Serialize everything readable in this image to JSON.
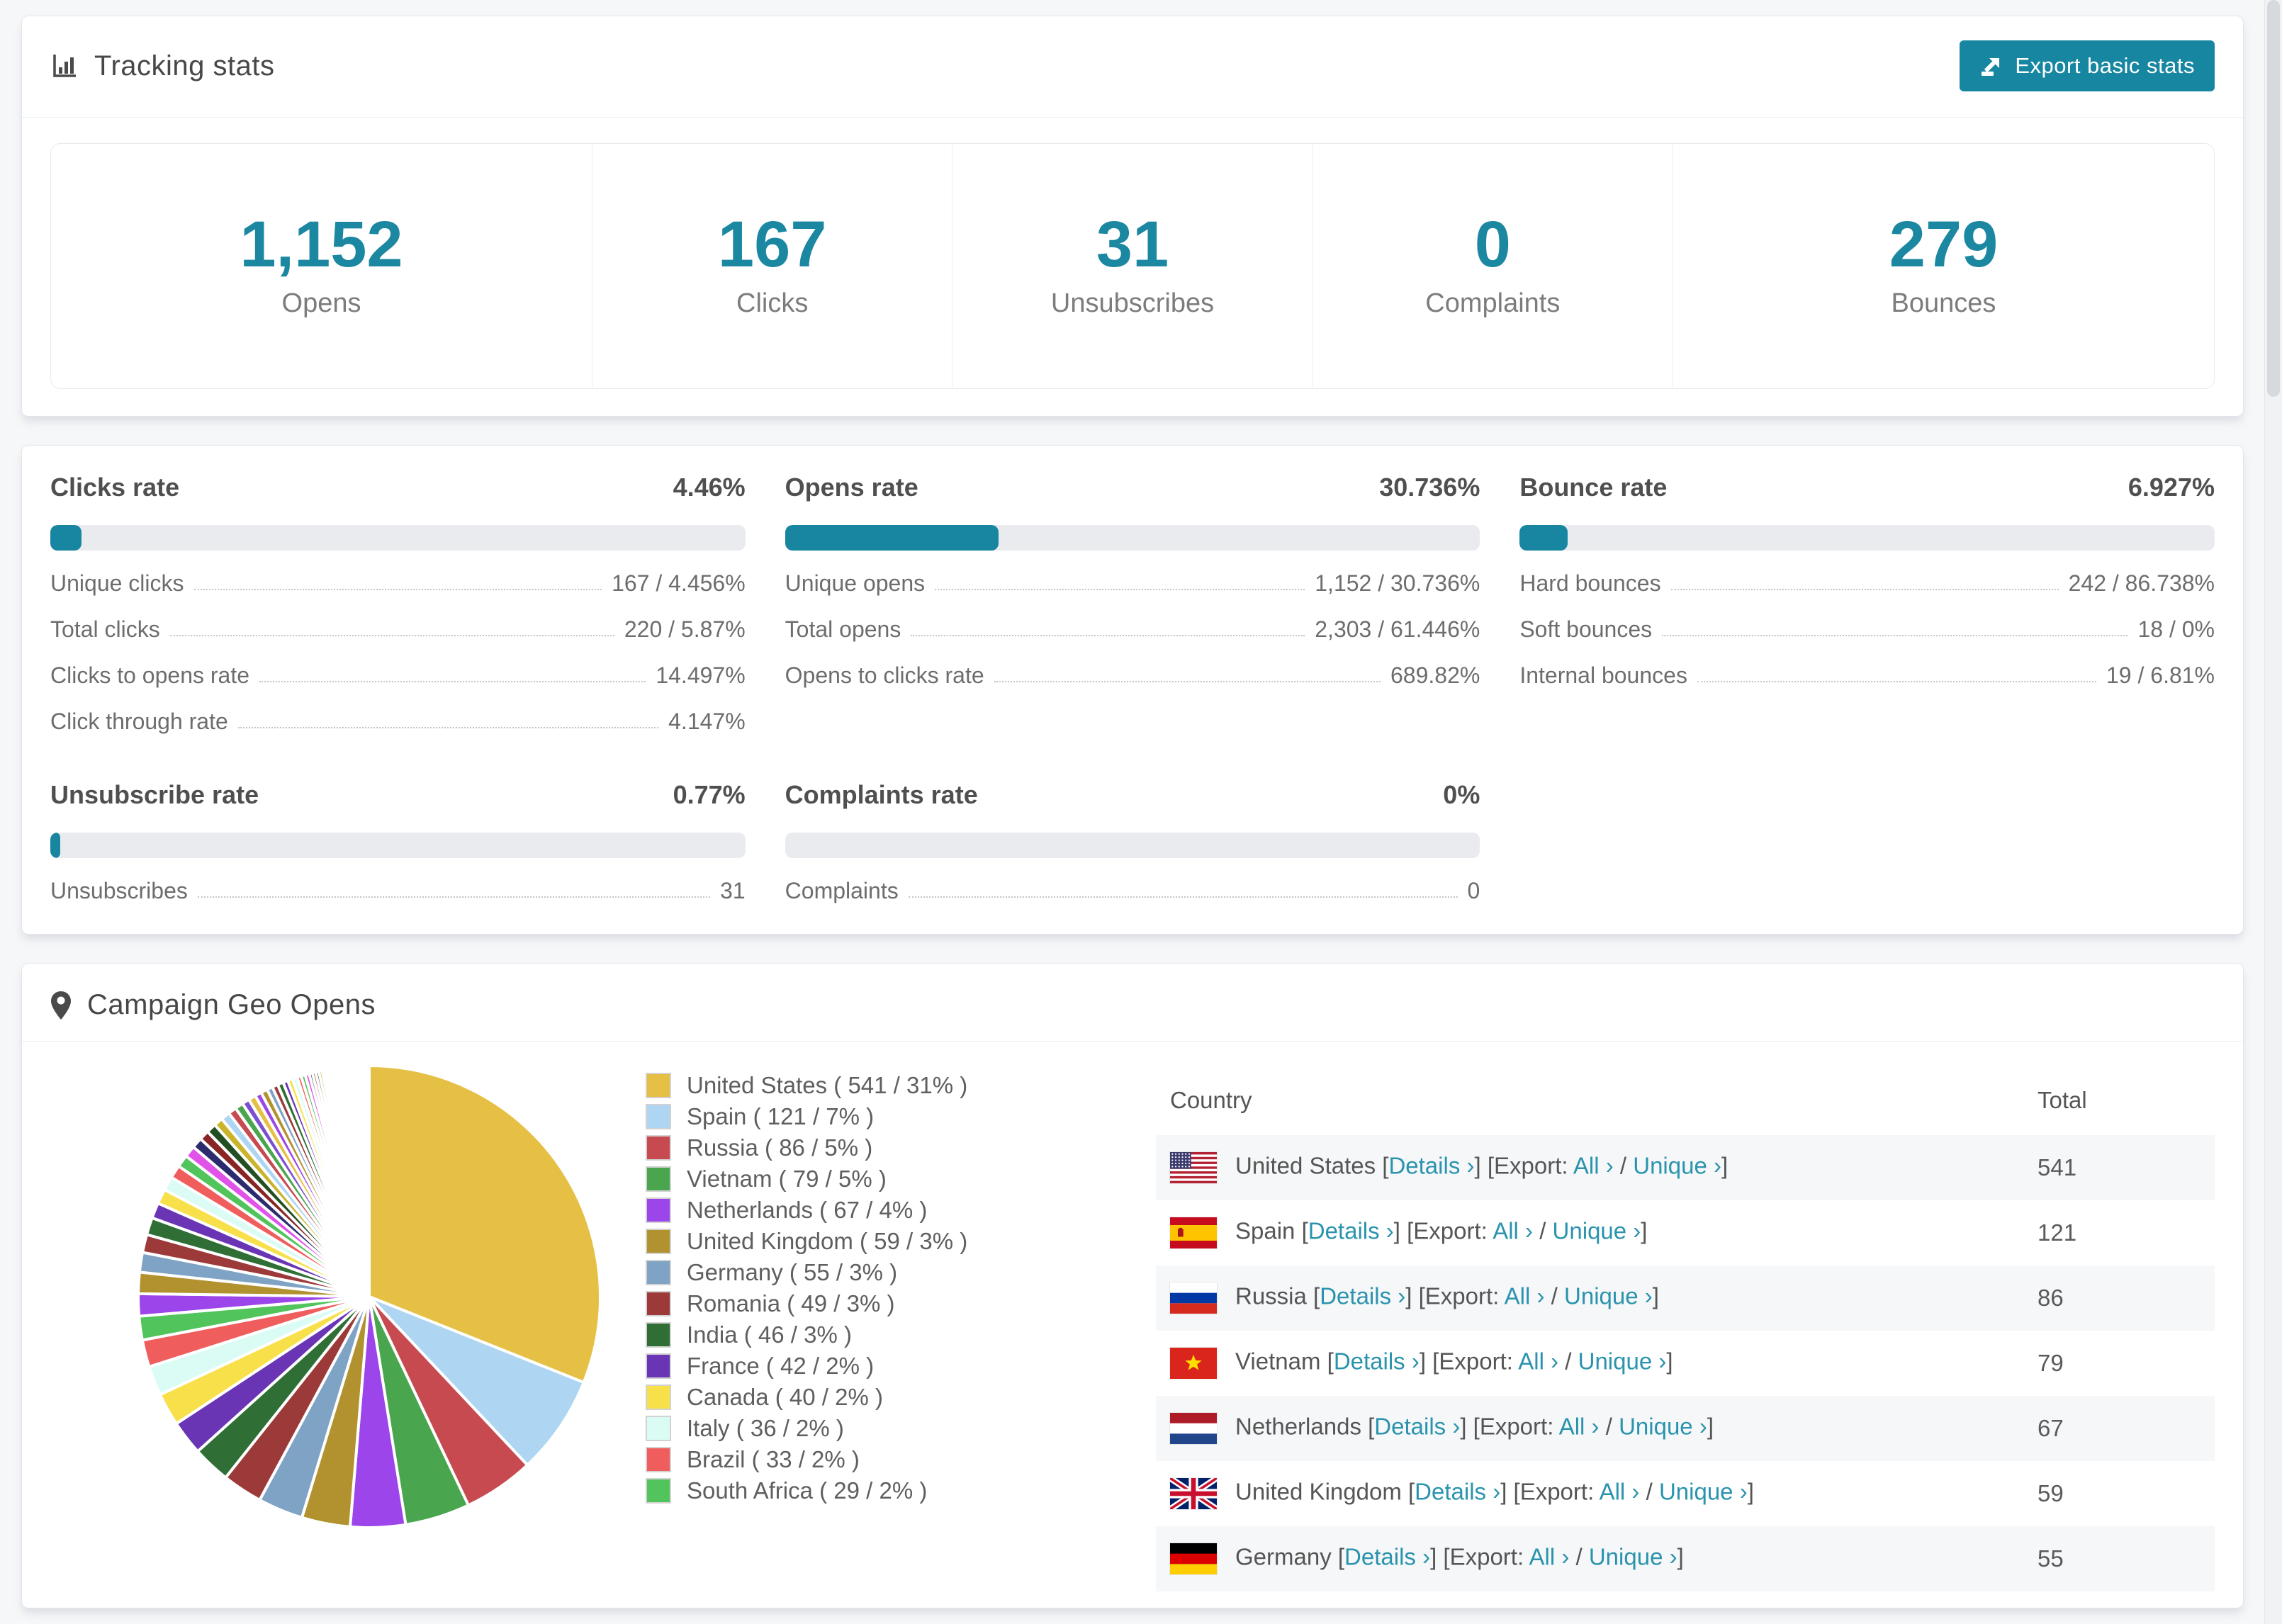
{
  "header": {
    "title": "Tracking stats",
    "export_label": "Export basic stats"
  },
  "summary": [
    {
      "value": "1,152",
      "label": "Opens"
    },
    {
      "value": "167",
      "label": "Clicks"
    },
    {
      "value": "31",
      "label": "Unsubscribes"
    },
    {
      "value": "0",
      "label": "Complaints"
    },
    {
      "value": "279",
      "label": "Bounces"
    }
  ],
  "rates": [
    {
      "title": "Clicks rate",
      "value": "4.46%",
      "percent": 4.46,
      "rows": [
        {
          "label": "Unique clicks",
          "value": "167 / 4.456%"
        },
        {
          "label": "Total clicks",
          "value": "220 / 5.87%"
        },
        {
          "label": "Clicks to opens rate",
          "value": "14.497%"
        },
        {
          "label": "Click through rate",
          "value": "4.147%"
        }
      ]
    },
    {
      "title": "Opens rate",
      "value": "30.736%",
      "percent": 30.736,
      "rows": [
        {
          "label": "Unique opens",
          "value": "1,152 / 30.736%"
        },
        {
          "label": "Total opens",
          "value": "2,303 / 61.446%"
        },
        {
          "label": "Opens to clicks rate",
          "value": "689.82%"
        }
      ]
    },
    {
      "title": "Bounce rate",
      "value": "6.927%",
      "percent": 6.927,
      "rows": [
        {
          "label": "Hard bounces",
          "value": "242 / 86.738%"
        },
        {
          "label": "Soft bounces",
          "value": "18 / 0%"
        },
        {
          "label": "Internal bounces",
          "value": "19 / 6.81%"
        }
      ]
    },
    {
      "title": "Unsubscribe rate",
      "value": "0.77%",
      "percent": 0.77,
      "rows": [
        {
          "label": "Unsubscribes",
          "value": "31"
        }
      ]
    },
    {
      "title": "Complaints rate",
      "value": "0%",
      "percent": 0,
      "rows": [
        {
          "label": "Complaints",
          "value": "0"
        }
      ]
    }
  ],
  "geo": {
    "title": "Campaign Geo Opens",
    "table": {
      "columns": [
        "Country",
        "Total"
      ],
      "link_labels": {
        "details": "Details ›",
        "export_prefix": "[Export: ",
        "all": "All ›",
        "separator": " / ",
        "unique": "Unique ›"
      },
      "rows": [
        {
          "country": "United States",
          "flag": "us",
          "total": "541"
        },
        {
          "country": "Spain",
          "flag": "es",
          "total": "121"
        },
        {
          "country": "Russia",
          "flag": "ru",
          "total": "86"
        },
        {
          "country": "Vietnam",
          "flag": "vn",
          "total": "79"
        },
        {
          "country": "Netherlands",
          "flag": "nl",
          "total": "67"
        },
        {
          "country": "United Kingdom",
          "flag": "gb",
          "total": "59"
        },
        {
          "country": "Germany",
          "flag": "de",
          "total": "55"
        }
      ]
    }
  },
  "chart_data": {
    "type": "pie",
    "title": "Campaign Geo Opens",
    "legend_position": "right",
    "start_angle_deg": 0,
    "direction": "clockwise",
    "series": [
      {
        "label": "United States",
        "value": 541,
        "share": "31%",
        "color": "#e5c044"
      },
      {
        "label": "Spain",
        "value": 121,
        "share": "7%",
        "color": "#aed5f2"
      },
      {
        "label": "Russia",
        "value": 86,
        "share": "5%",
        "color": "#c74a50"
      },
      {
        "label": "Vietnam",
        "value": 79,
        "share": "5%",
        "color": "#4aa64e"
      },
      {
        "label": "Netherlands",
        "value": 67,
        "share": "4%",
        "color": "#9b45ea"
      },
      {
        "label": "United Kingdom",
        "value": 59,
        "share": "3%",
        "color": "#b2922f"
      },
      {
        "label": "Germany",
        "value": 55,
        "share": "3%",
        "color": "#7fa3c4"
      },
      {
        "label": "Romania",
        "value": 49,
        "share": "3%",
        "color": "#9c3a3a"
      },
      {
        "label": "India",
        "value": 46,
        "share": "3%",
        "color": "#2f6e35"
      },
      {
        "label": "France",
        "value": 42,
        "share": "2%",
        "color": "#6a35b5"
      },
      {
        "label": "Canada",
        "value": 40,
        "share": "2%",
        "color": "#f7e04a"
      },
      {
        "label": "Italy",
        "value": 36,
        "share": "2%",
        "color": "#dafcf4"
      },
      {
        "label": "Brazil",
        "value": 33,
        "share": "2%",
        "color": "#ef5d5d"
      },
      {
        "label": "South Africa",
        "value": 29,
        "share": "2%",
        "color": "#52c45c"
      }
    ],
    "others_values": [
      27,
      26,
      24,
      22,
      21,
      19,
      18,
      17,
      16,
      15,
      14,
      13,
      12,
      12,
      11,
      11,
      10,
      10,
      9,
      9,
      8,
      8,
      7,
      7,
      7,
      6,
      6,
      6,
      5,
      5,
      5,
      4,
      4,
      4,
      4,
      3,
      3,
      3,
      3,
      3,
      3,
      2,
      2,
      2,
      2,
      2,
      2,
      2,
      2,
      2,
      2,
      1,
      1,
      1,
      1,
      1,
      1,
      1,
      1,
      1,
      1,
      1,
      1,
      1,
      1,
      1,
      1,
      1,
      1,
      1
    ],
    "others_palette": [
      "#9b45ea",
      "#b2922f",
      "#7fa3c4",
      "#9c3a3a",
      "#2f6e35",
      "#6a35b5",
      "#f7e04a",
      "#dafcf4",
      "#ef5d5d",
      "#52c45c",
      "#e052e8",
      "#2b2b6e",
      "#8a2525",
      "#234f23",
      "#c9b42c",
      "#aed5f2",
      "#c74a50",
      "#4aa64e",
      "#7b4fd0",
      "#e5c044"
    ],
    "white_gap_stroke": "#ffffff"
  }
}
